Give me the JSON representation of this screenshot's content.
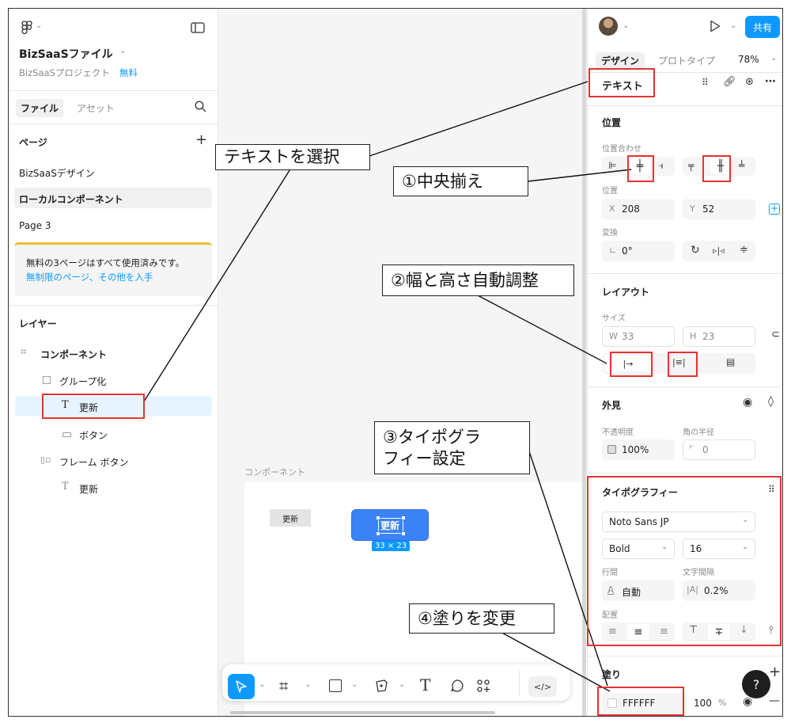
{
  "left_panel": {
    "file_title": "BizSaaSファイル",
    "project_name": "BizSaaSプロジェクト",
    "plan_badge": "無料",
    "tabs": [
      "ファイル",
      "アセット"
    ],
    "pages_heading": "ページ",
    "pages": [
      "BizSaaSデザイン",
      "ローカルコンポーネント",
      "Page 3"
    ],
    "notice_text": "無料の3ページはすべて使用済みです。",
    "notice_link": "無制限のページ、その他を入手",
    "layers_heading": "レイヤー",
    "layers": [
      {
        "label": "コンポーネント",
        "icon": "grid-hash-icon"
      },
      {
        "label": "グループ化",
        "icon": "dashed-square-icon"
      },
      {
        "label": "更新",
        "icon": "text-t-icon"
      },
      {
        "label": "ボタン",
        "icon": "rectangle-icon"
      },
      {
        "label": "フレーム ボタン",
        "icon": "frame-icon"
      },
      {
        "label": "更新",
        "icon": "text-t-icon"
      }
    ]
  },
  "canvas": {
    "section_label": "コンポーネント",
    "small_button_label": "更新",
    "selected_button_label": "更新",
    "size_badge": "33 × 23"
  },
  "right_panel": {
    "share_button": "共有",
    "tabs": [
      "デザイン",
      "プロトタイプ"
    ],
    "zoom": "78%",
    "selection_type": "テキスト",
    "position_heading": "位置",
    "alignment_label": "位置合わせ",
    "position_label": "位置",
    "x_label": "X",
    "x_value": "208",
    "y_label": "Y",
    "y_value": "52",
    "transform_label": "変換",
    "rotation_value": "0°",
    "layout_heading": "レイアウト",
    "size_label": "サイズ",
    "w_label": "W",
    "w_value": "33",
    "h_label": "H",
    "h_value": "23",
    "appearance_heading": "外見",
    "opacity_label": "不透明度",
    "opacity_value": "100%",
    "radius_label": "角の半径",
    "radius_value": "0",
    "typography_heading": "タイポグラフィー",
    "font_family": "Noto Sans JP",
    "font_weight": "Bold",
    "font_size": "16",
    "line_height_label": "行間",
    "line_height_value": "自動",
    "letter_spacing_label": "文字間隔",
    "letter_spacing_value": "0.2%",
    "align_label": "配置",
    "fill_heading": "塗り",
    "fill_hex": "FFFFFF",
    "fill_opacity": "100",
    "fill_opacity_unit": "%",
    "help": "?"
  },
  "callouts": {
    "select_text": "テキストを選択",
    "center_align": "①中央揃え",
    "auto_size": "②幅と高さ自動調整",
    "typography_line1": "③タイポグラ",
    "typography_line2": "フィー設定",
    "change_fill": "④塗りを変更"
  },
  "colors": {
    "accent_blue": "#0d99ff",
    "selection_red": "#e3342f",
    "button_blue": "#3b82f6"
  }
}
